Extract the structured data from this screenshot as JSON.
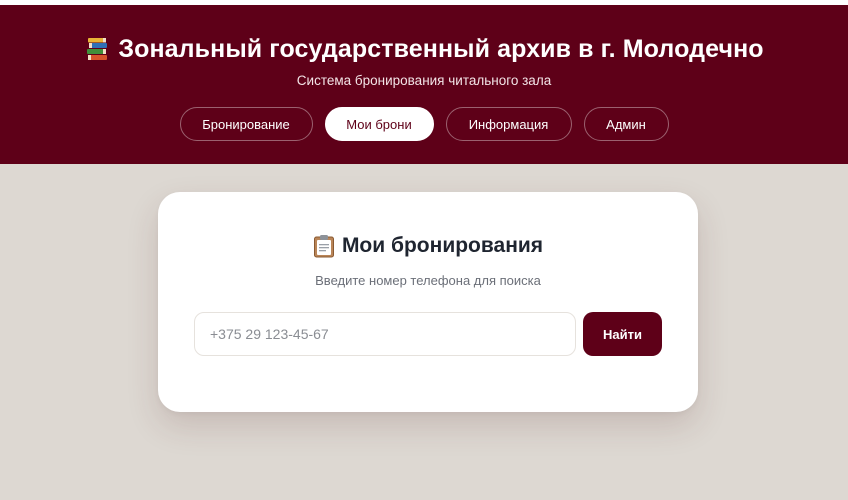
{
  "header": {
    "icon": "books-icon",
    "title": "Зональный государственный архив в г. Молодечно",
    "subtitle": "Система бронирования читального зала",
    "nav": [
      {
        "label": "Бронирование",
        "active": false
      },
      {
        "label": "Мои брони",
        "active": true
      },
      {
        "label": "Информация",
        "active": false
      },
      {
        "label": "Админ",
        "active": false
      }
    ]
  },
  "card": {
    "icon": "clipboard-icon",
    "title": "Мои бронирования",
    "hint": "Введите номер телефона для поиска",
    "phone_value": "",
    "phone_placeholder": "+375 29 123-45-67",
    "search_label": "Найти"
  },
  "colors": {
    "brand": "#5e0018",
    "background": "#ddd8d2",
    "card": "#ffffff"
  }
}
